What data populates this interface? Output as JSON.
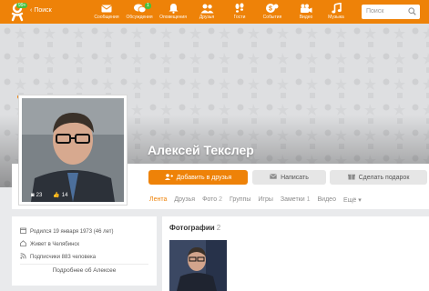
{
  "header": {
    "back_label": "Поиск",
    "logo_badge": "99+",
    "nav": [
      {
        "label": "Сообщения",
        "icon": "envelope-icon"
      },
      {
        "label": "Обсуждения",
        "icon": "chat-bubbles-icon",
        "badge": "1"
      },
      {
        "label": "Оповещения",
        "icon": "bell-icon"
      },
      {
        "label": "Друзья",
        "icon": "friends-icon"
      },
      {
        "label": "Гости",
        "icon": "footprints-icon"
      },
      {
        "label": "События",
        "icon": "events-icon"
      },
      {
        "label": "Видео",
        "icon": "video-camera-icon"
      },
      {
        "label": "Музыка",
        "icon": "music-note-icon"
      }
    ],
    "search_placeholder": "Поиск"
  },
  "profile": {
    "name": "Алексей Текслер",
    "avatar_stats": {
      "photos": "23",
      "likes": "14"
    },
    "buttons": {
      "add_friend": "Добавить в друзья",
      "write": "Написать",
      "gift": "Сделать подарок"
    },
    "tabs": [
      {
        "label": "Лента",
        "count": ""
      },
      {
        "label": "Друзья",
        "count": ""
      },
      {
        "label": "Фото",
        "count": "2"
      },
      {
        "label": "Группы",
        "count": ""
      },
      {
        "label": "Игры",
        "count": ""
      },
      {
        "label": "Заметки",
        "count": "1"
      },
      {
        "label": "Видео",
        "count": ""
      },
      {
        "label": "Ещё",
        "count": ""
      }
    ]
  },
  "info": {
    "born": "Родился 19 января 1973 (46 лет)",
    "lives": "Живет в Челябинск",
    "subscribers": "Подписчики 883 человека",
    "more": "Подробнее об Алексее"
  },
  "photos": {
    "title": "Фотографии",
    "count": "2"
  },
  "colors": {
    "accent": "#ee8208",
    "badge_green": "#48c03d"
  }
}
